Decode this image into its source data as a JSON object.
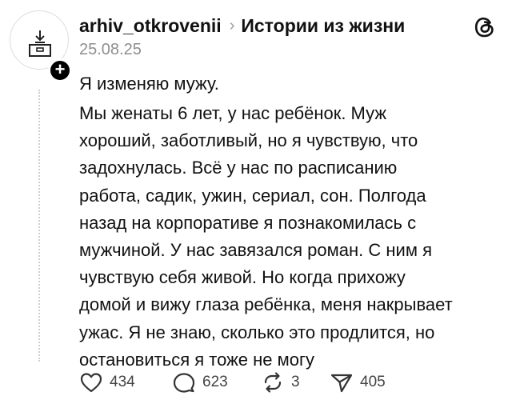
{
  "header": {
    "username": "arhiv_otkrovenii",
    "separator": "›",
    "community": "Истории из жизни",
    "date": "25.08.25"
  },
  "icons": {
    "avatar": "archive-box-icon",
    "follow": "plus-icon",
    "app_logo": "threads-logo-icon",
    "like": "heart-icon",
    "comment": "comment-bubble-icon",
    "repost": "repost-icon",
    "share": "send-icon"
  },
  "post": {
    "title": "Я изменяю мужу.",
    "lines": [
      "Мы женаты 6 лет, у нас ребёнок. Муж",
      "хороший, заботливый, но я чувствую, что",
      "задохнулась. Всё у нас по расписанию",
      "работа, садик, ужин, сериал, сон. Полгода",
      "назад на корпоративе я познакомилась с",
      "мужчиной. У нас завязался роман. С ним я",
      "чувствую себя живой. Но когда прихожу",
      "домой и вижу глаза ребёнка, меня накрывает",
      "ужас. Я не знаю, сколько это продлится, но",
      "остановиться я тоже не могу"
    ]
  },
  "stats": {
    "likes": "434",
    "comments": "623",
    "reposts": "3",
    "shares": "405"
  },
  "colors": {
    "text": "#111111",
    "muted": "#8e8e8e",
    "icon": "#333333",
    "badge": "#000000"
  }
}
